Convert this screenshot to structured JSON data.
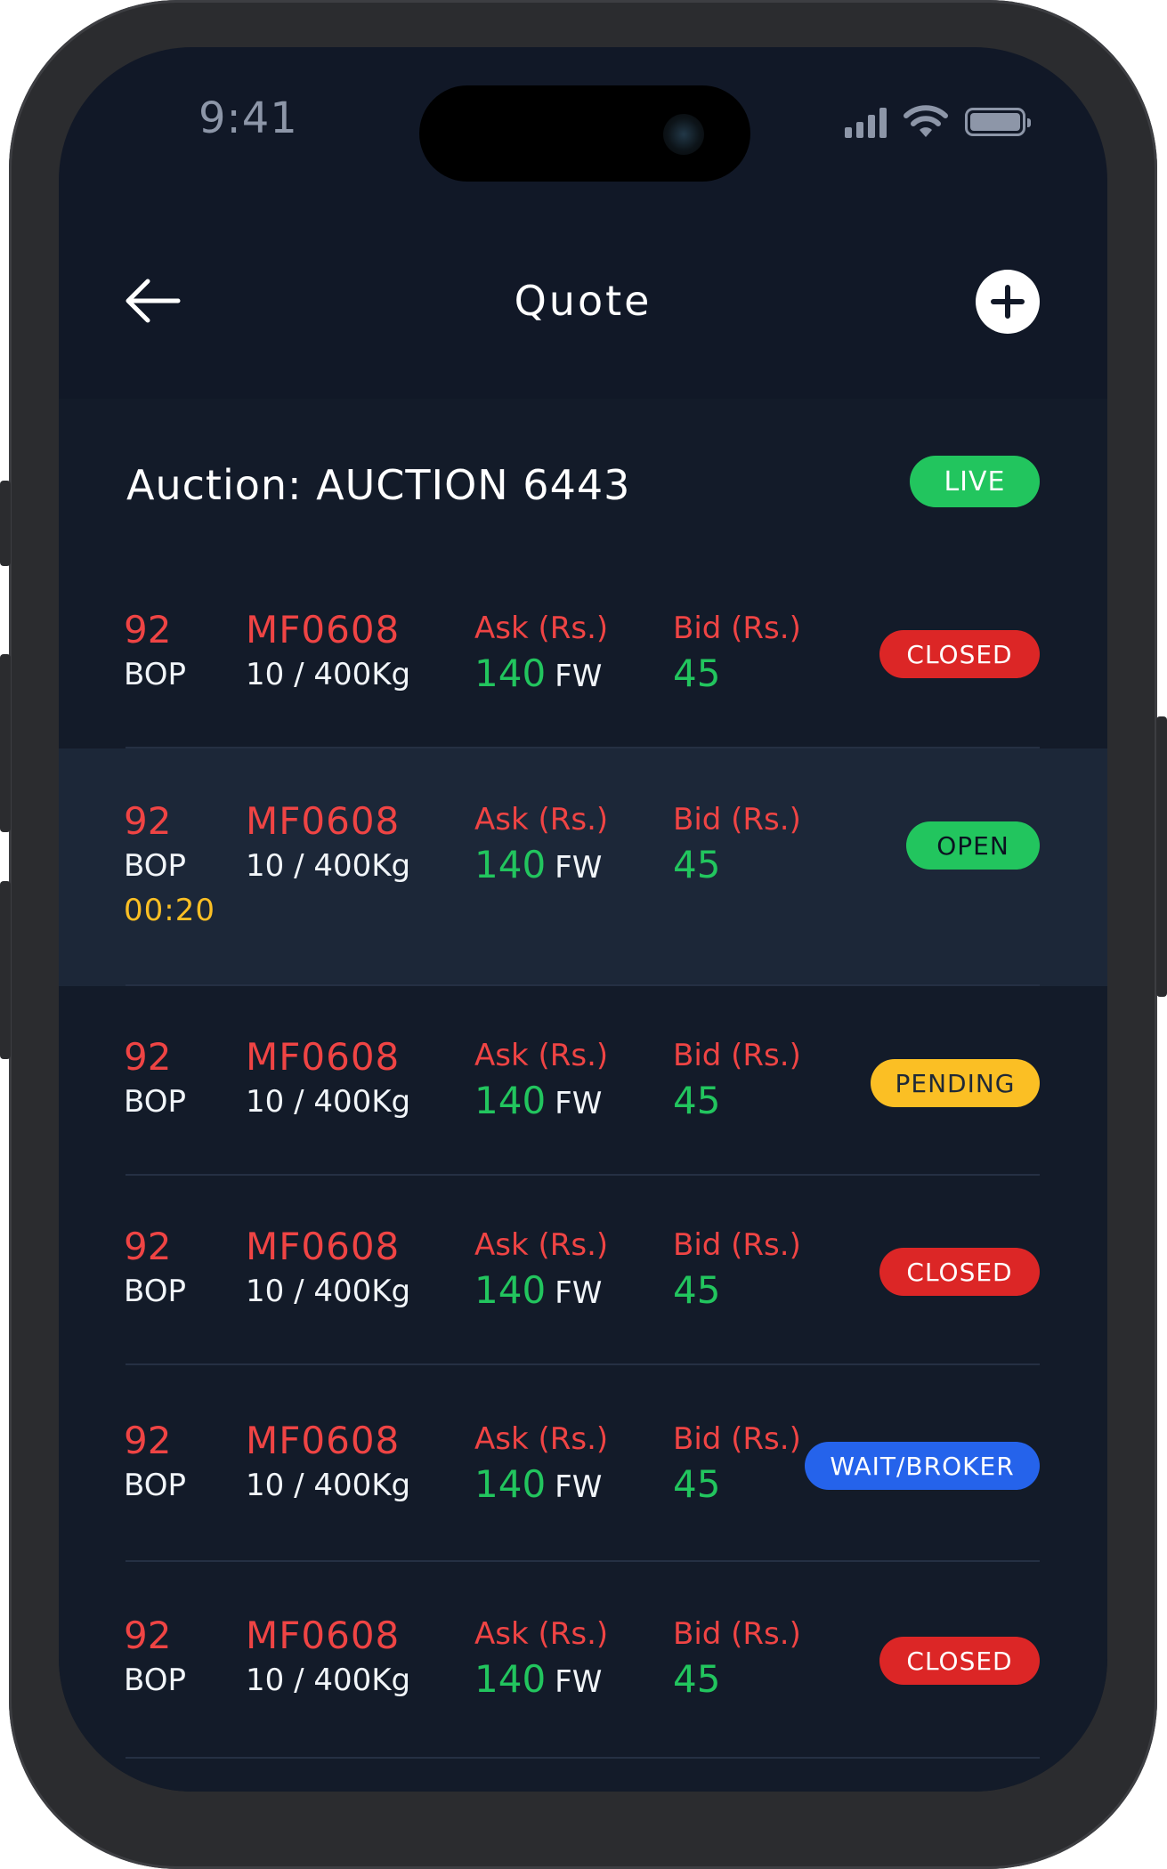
{
  "status_bar": {
    "time": "9:41",
    "icons": [
      "signal-icon",
      "wifi-icon",
      "battery-icon"
    ]
  },
  "header": {
    "title": "Quote",
    "back_icon": "arrow-left-icon",
    "add_icon": "plus-circle-icon"
  },
  "auction": {
    "title": "Auction: AUCTION 6443",
    "status": "LIVE"
  },
  "labels": {
    "ask": "Ask (Rs.)",
    "bid": "Bid (Rs.)",
    "ask_unit": "FW"
  },
  "lots": [
    {
      "lot_no": "92",
      "grade": "BOP",
      "mark": "MF0608",
      "qty": "10 / 400Kg",
      "ask": "140",
      "bid": "45",
      "status": "CLOSED",
      "timer": ""
    },
    {
      "lot_no": "92",
      "grade": "BOP",
      "mark": "MF0608",
      "qty": "10 / 400Kg",
      "ask": "140",
      "bid": "45",
      "status": "OPEN",
      "timer": "00:20"
    },
    {
      "lot_no": "92",
      "grade": "BOP",
      "mark": "MF0608",
      "qty": "10 / 400Kg",
      "ask": "140",
      "bid": "45",
      "status": "PENDING",
      "timer": ""
    },
    {
      "lot_no": "92",
      "grade": "BOP",
      "mark": "MF0608",
      "qty": "10 / 400Kg",
      "ask": "140",
      "bid": "45",
      "status": "CLOSED",
      "timer": ""
    },
    {
      "lot_no": "92",
      "grade": "BOP",
      "mark": "MF0608",
      "qty": "10 / 400Kg",
      "ask": "140",
      "bid": "45",
      "status": "WAIT/BROKER",
      "timer": ""
    },
    {
      "lot_no": "92",
      "grade": "BOP",
      "mark": "MF0608",
      "qty": "10 / 400Kg",
      "ask": "140",
      "bid": "45",
      "status": "CLOSED",
      "timer": ""
    }
  ],
  "colors": {
    "background": "#111827",
    "live": "#22c55e",
    "closed": "#dc2626",
    "open": "#22c55e",
    "pending": "#fbbf24",
    "wait_broker": "#2563eb",
    "accent_red": "#ef4444",
    "accent_green": "#22c55e"
  }
}
